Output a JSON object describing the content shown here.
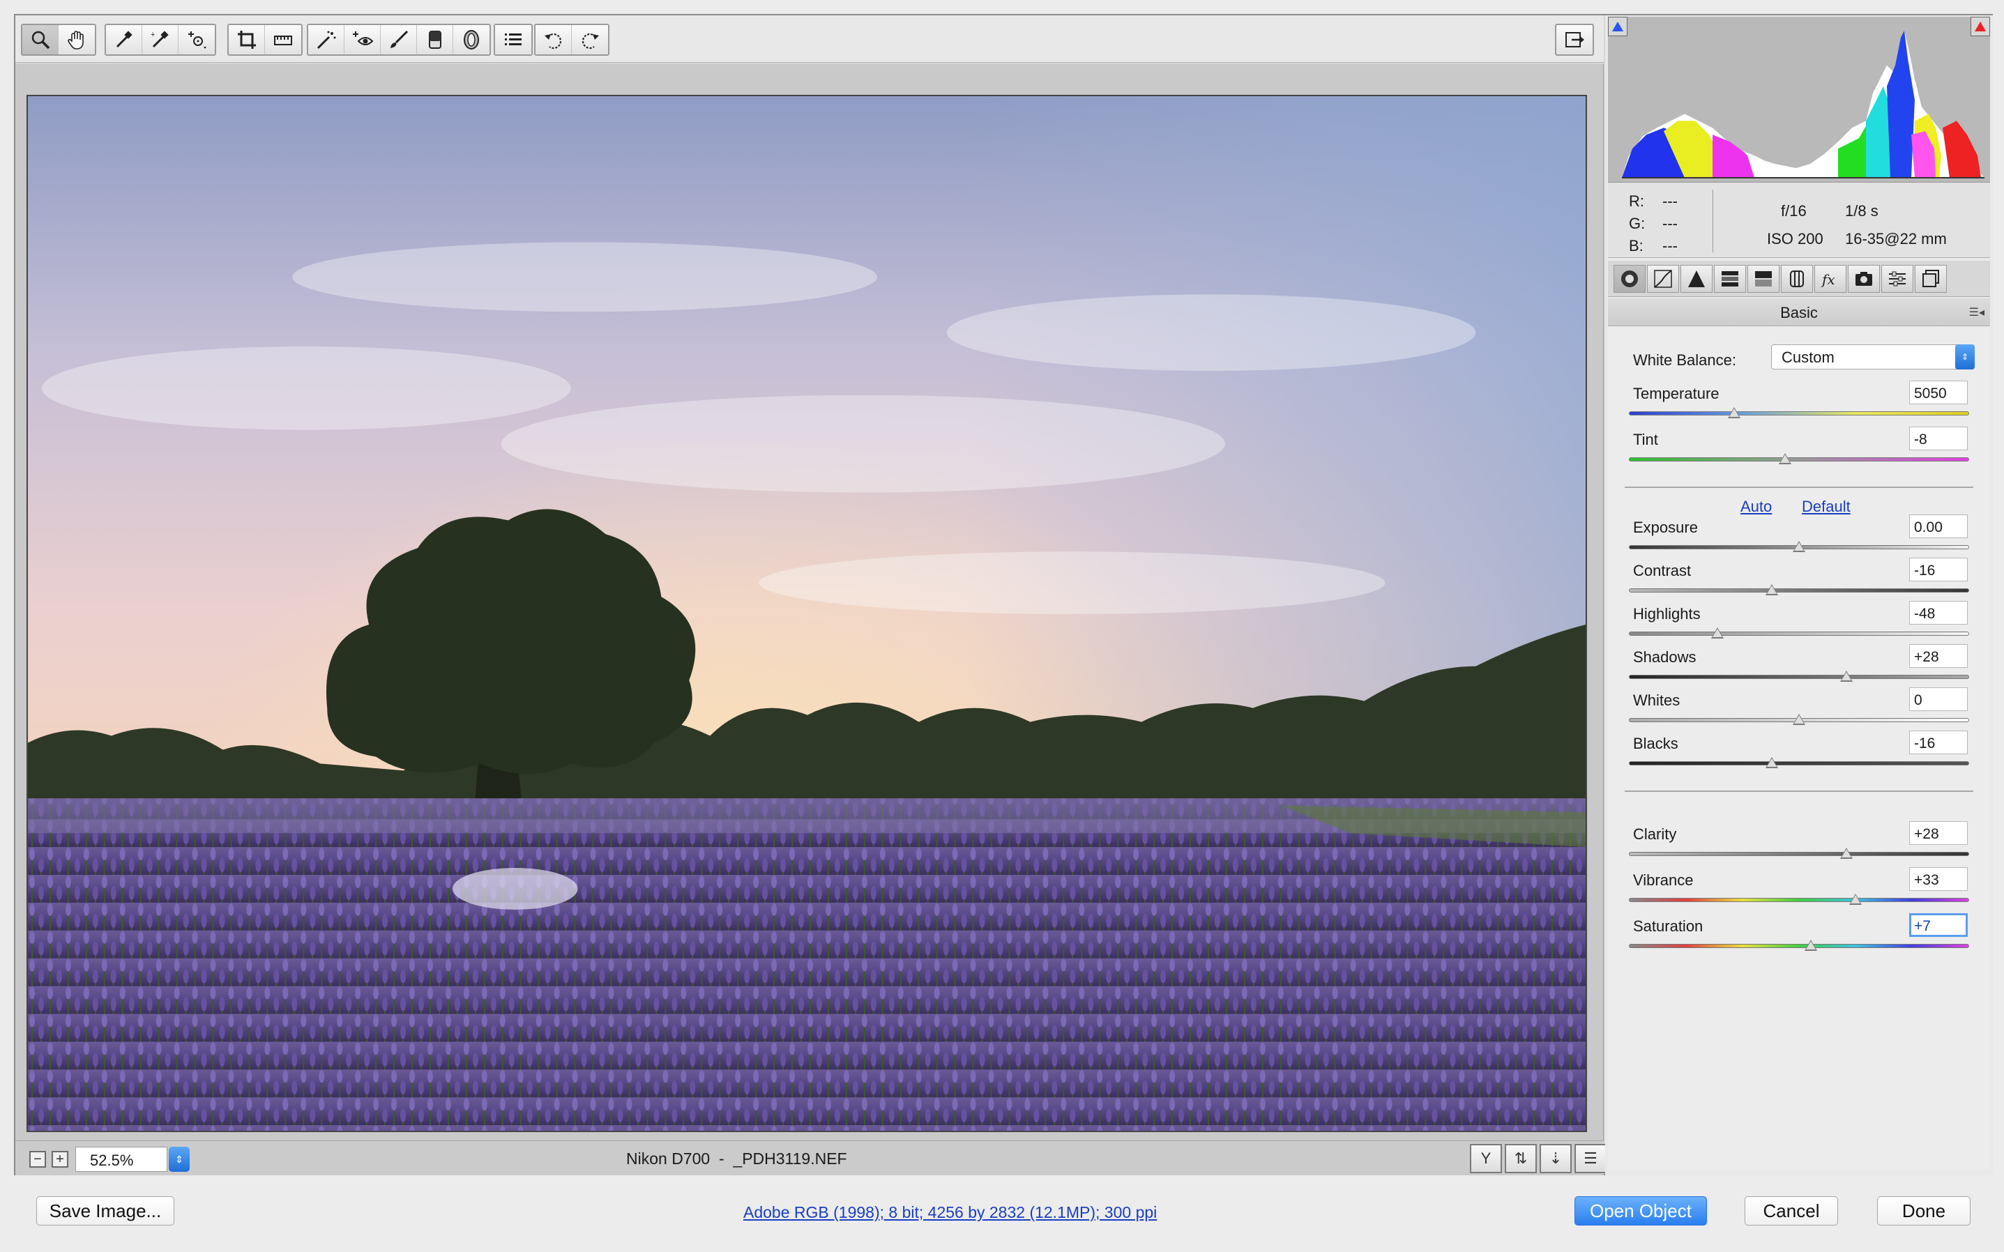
{
  "toolbar": {
    "tools": [
      "zoom-tool-icon",
      "hand-tool-icon",
      "white-balance-tool-icon",
      "color-sampler-tool-icon",
      "targeted-adjustment-tool-icon",
      "crop-tool-icon",
      "straighten-tool-icon",
      "spot-removal-tool-icon",
      "red-eye-removal-tool-icon",
      "adjustment-brush-icon",
      "graduated-filter-icon",
      "radial-filter-icon",
      "open-preferences-icon",
      "rotate-left-icon",
      "rotate-right-icon"
    ],
    "fullscreen_icon": "toggle-fullscreen-icon"
  },
  "status": {
    "zoom": "52.5%",
    "file_label": "Nikon D700  -  _PDH3119.NEF"
  },
  "info": {
    "r_label": "R:",
    "r_value": "---",
    "g_label": "G:",
    "g_value": "---",
    "b_label": "B:",
    "b_value": "---",
    "aperture": "f/16",
    "shutter": "1/8 s",
    "iso": "ISO 200",
    "lens": "16-35@22 mm"
  },
  "panel": {
    "title": "Basic",
    "white_balance_label": "White Balance:",
    "white_balance_value": "Custom",
    "auto_link": "Auto",
    "default_link": "Default",
    "sliders": [
      {
        "label": "Temperature",
        "value": "5050",
        "pos": 0.31
      },
      {
        "label": "Tint",
        "value": "-8",
        "pos": 0.46
      },
      {
        "label": "Exposure",
        "value": "0.00",
        "pos": 0.5
      },
      {
        "label": "Contrast",
        "value": "-16",
        "pos": 0.42
      },
      {
        "label": "Highlights",
        "value": "-48",
        "pos": 0.26
      },
      {
        "label": "Shadows",
        "value": "+28",
        "pos": 0.64
      },
      {
        "label": "Whites",
        "value": "0",
        "pos": 0.5
      },
      {
        "label": "Blacks",
        "value": "-16",
        "pos": 0.42
      },
      {
        "label": "Clarity",
        "value": "+28",
        "pos": 0.64
      },
      {
        "label": "Vibrance",
        "value": "+33",
        "pos": 0.665
      },
      {
        "label": "Saturation",
        "value": "+7",
        "pos": 0.535
      }
    ]
  },
  "bottom": {
    "save_label": "Save Image...",
    "workflow_link": "Adobe RGB (1998); 8 bit; 4256 by 2832 (12.1MP); 300 ppi",
    "open_label": "Open Object",
    "cancel_label": "Cancel",
    "done_label": "Done"
  },
  "colors": {
    "accent": "#2a7ff0",
    "link": "#1a3fbf"
  }
}
